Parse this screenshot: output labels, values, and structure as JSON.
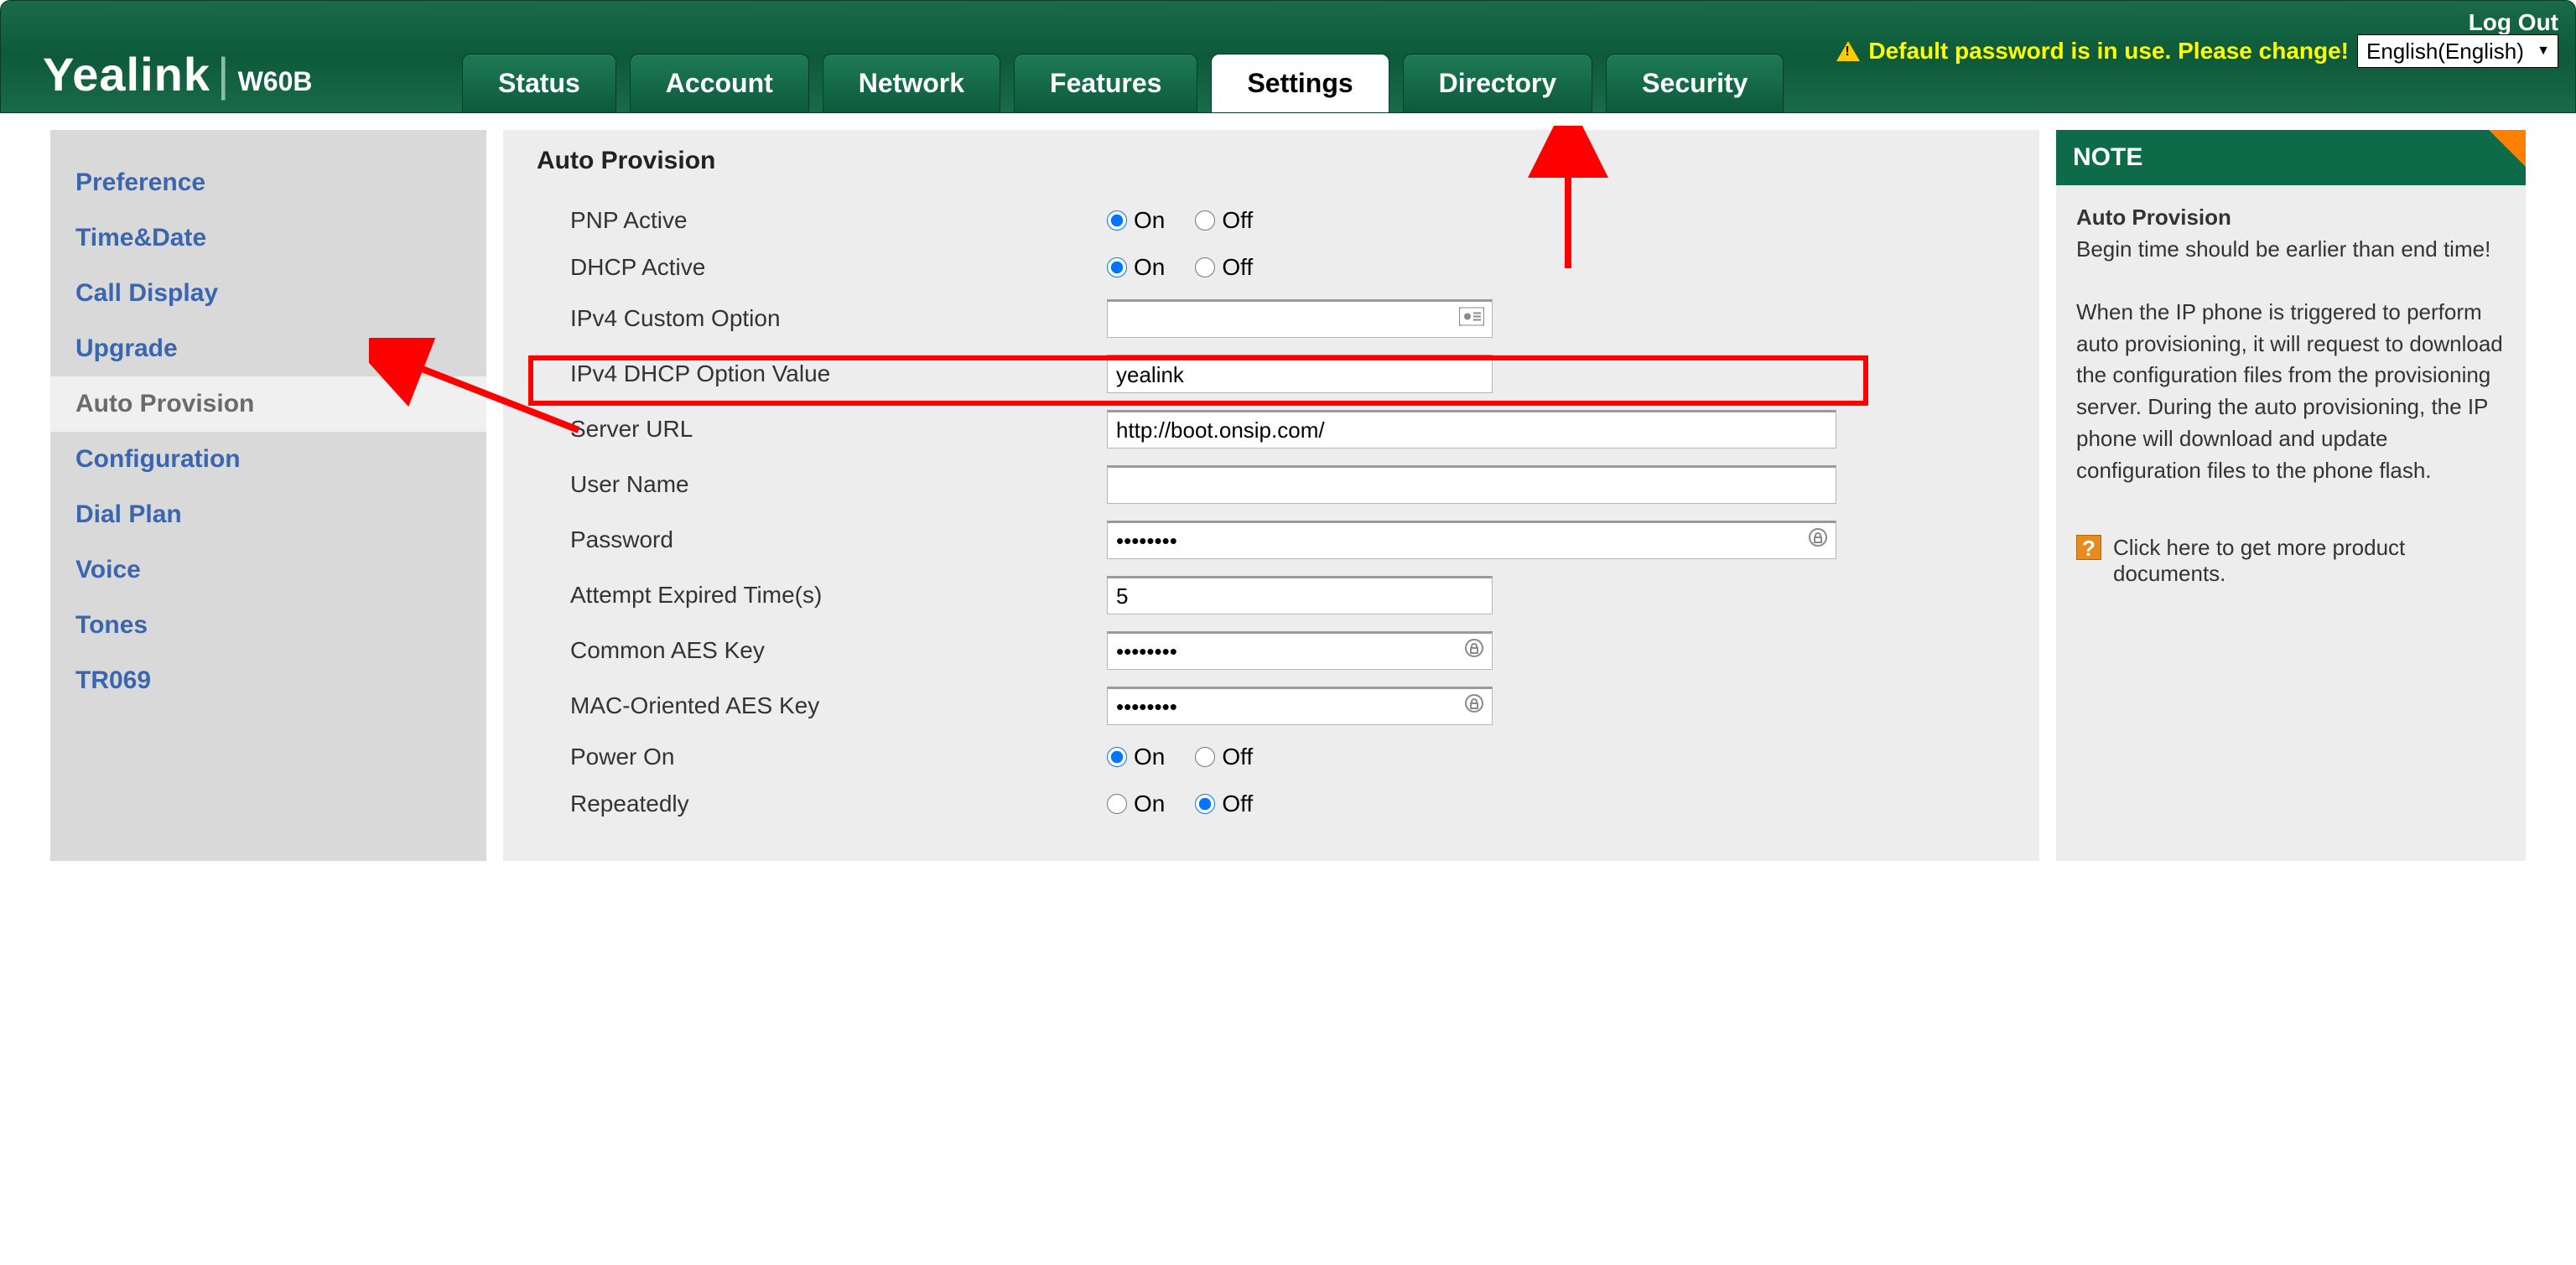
{
  "header": {
    "logout": "Log Out",
    "warning": "Default password is in use. Please change!",
    "language": "English(English)",
    "logo": "Yealink",
    "model": "W60B"
  },
  "tabs": [
    "Status",
    "Account",
    "Network",
    "Features",
    "Settings",
    "Directory",
    "Security"
  ],
  "active_tab": "Settings",
  "sidebar": {
    "items": [
      "Preference",
      "Time&Date",
      "Call Display",
      "Upgrade",
      "Auto Provision",
      "Configuration",
      "Dial Plan",
      "Voice",
      "Tones",
      "TR069"
    ],
    "active": "Auto Provision"
  },
  "section": {
    "title": "Auto Provision",
    "labels": {
      "pnp": "PNP Active",
      "dhcp": "DHCP Active",
      "ipv4custom": "IPv4 Custom Option",
      "ipv4dhcp": "IPv4 DHCP Option Value",
      "serverurl": "Server URL",
      "username": "User Name",
      "password": "Password",
      "attempt": "Attempt Expired Time(s)",
      "commonaes": "Common AES Key",
      "macaes": "MAC-Oriented AES Key",
      "poweron": "Power On",
      "repeatedly": "Repeatedly"
    },
    "radio": {
      "on": "On",
      "off": "Off"
    },
    "values": {
      "pnp": "On",
      "dhcp": "On",
      "ipv4custom": "",
      "ipv4dhcp": "yealink",
      "serverurl": "http://boot.onsip.com/",
      "username": "",
      "password": "••••••••",
      "attempt": "5",
      "commonaes": "••••••••",
      "macaes": "••••••••",
      "poweron": "On",
      "repeatedly": "Off"
    }
  },
  "note": {
    "title": "NOTE",
    "heading": "Auto Provision",
    "line1": "Begin time should be earlier than end time!",
    "body": "When the IP phone is triggered to perform auto provisioning, it will request to download the configuration files from the provisioning server. During the auto provisioning, the IP phone will download and update configuration files to the phone flash.",
    "link": "Click here to get more product documents."
  }
}
